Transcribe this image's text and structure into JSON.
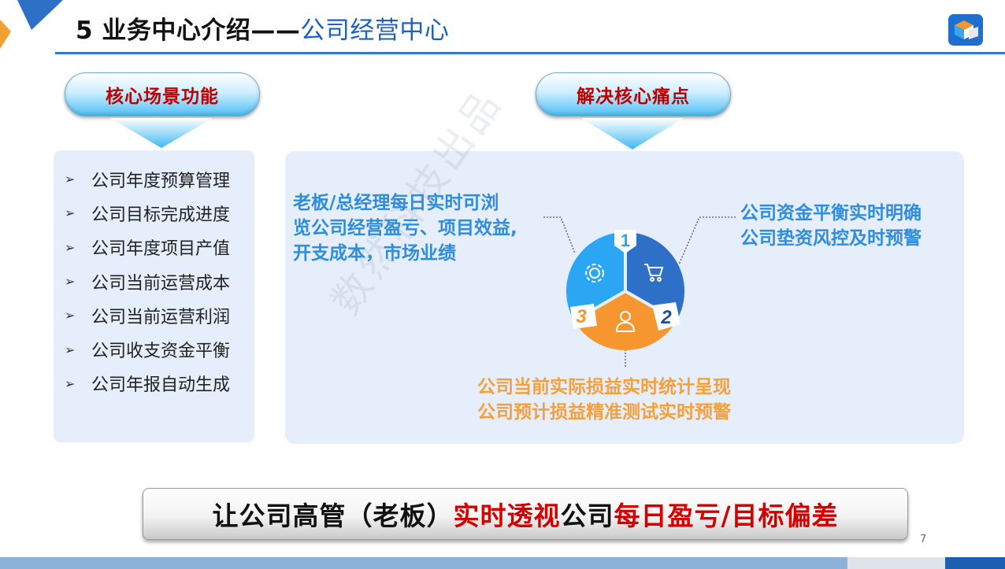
{
  "slide": {
    "title_black": "5 业务中心介绍——",
    "title_blue": "公司经营中心",
    "page_number": "7"
  },
  "left_section": {
    "header": "核心场景功能",
    "items": [
      "公司年度预算管理",
      "公司目标完成进度",
      "公司年度项目产值",
      "公司当前运营成本",
      "公司当前运营利润",
      "公司收支资金平衡",
      "公司年报自动生成"
    ],
    "bullet_glyph": "➢"
  },
  "right_section": {
    "header": "解决核心痛点",
    "pain_points": {
      "top_left": [
        "老板/总经理每日实时可浏",
        "览公司经营盈亏、项目效益,",
        "开支成本，市场业绩"
      ],
      "top_right": [
        "公司资金平衡实时明确",
        "公司垫资风控及时预警"
      ],
      "bottom": [
        "公司当前实际损益实时统计呈现",
        "公司预计损益精准测试实时预警"
      ]
    },
    "donut": {
      "segments": [
        {
          "number": "1",
          "icon": "gear-icon",
          "color": "#2aa6f2"
        },
        {
          "number": "2",
          "icon": "cart-icon",
          "color": "#2e6fc8"
        },
        {
          "number": "3",
          "icon": "user-icon",
          "color": "#f5962e"
        }
      ]
    },
    "watermark": "数然科技出品"
  },
  "banner": {
    "part1": "让公司高管（老板）",
    "part2": "实时透视",
    "part3": "公司",
    "part4": "每日盈亏/目标偏差"
  },
  "colors": {
    "accent_blue": "#2d7bd0",
    "alert_red": "#c00000",
    "pain_blue": "#2e8ddc",
    "pain_orange": "#f5a03a"
  }
}
